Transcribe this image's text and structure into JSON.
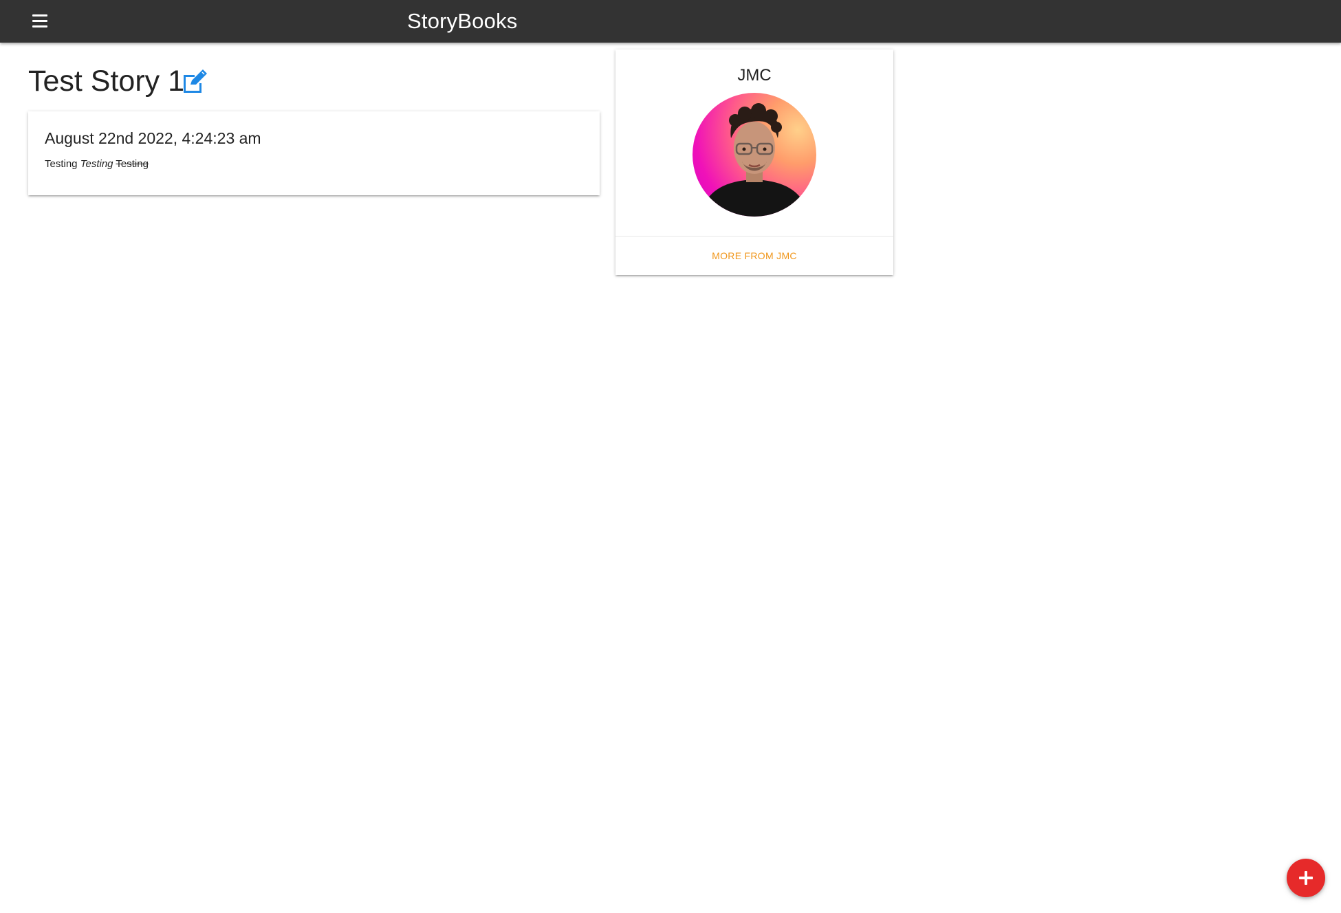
{
  "navbar": {
    "brand": "StoryBooks",
    "menu_icon": "hamburger-menu-icon"
  },
  "story": {
    "title": "Test Story 1",
    "edit_icon": "edit-icon",
    "date": "August 22nd 2022, 4:24:23 am",
    "body": {
      "bold_text": "Testing",
      "italic_text": "Testing",
      "strike_text": "Testing"
    }
  },
  "author": {
    "name": "JMC",
    "more_link": "MORE FROM JMC"
  },
  "fab": {
    "icon": "plus-icon"
  },
  "colors": {
    "navbar": "#333333",
    "accent_link": "#f0961a",
    "edit_icon": "#1e88e5",
    "fab": "#e62a2a"
  }
}
